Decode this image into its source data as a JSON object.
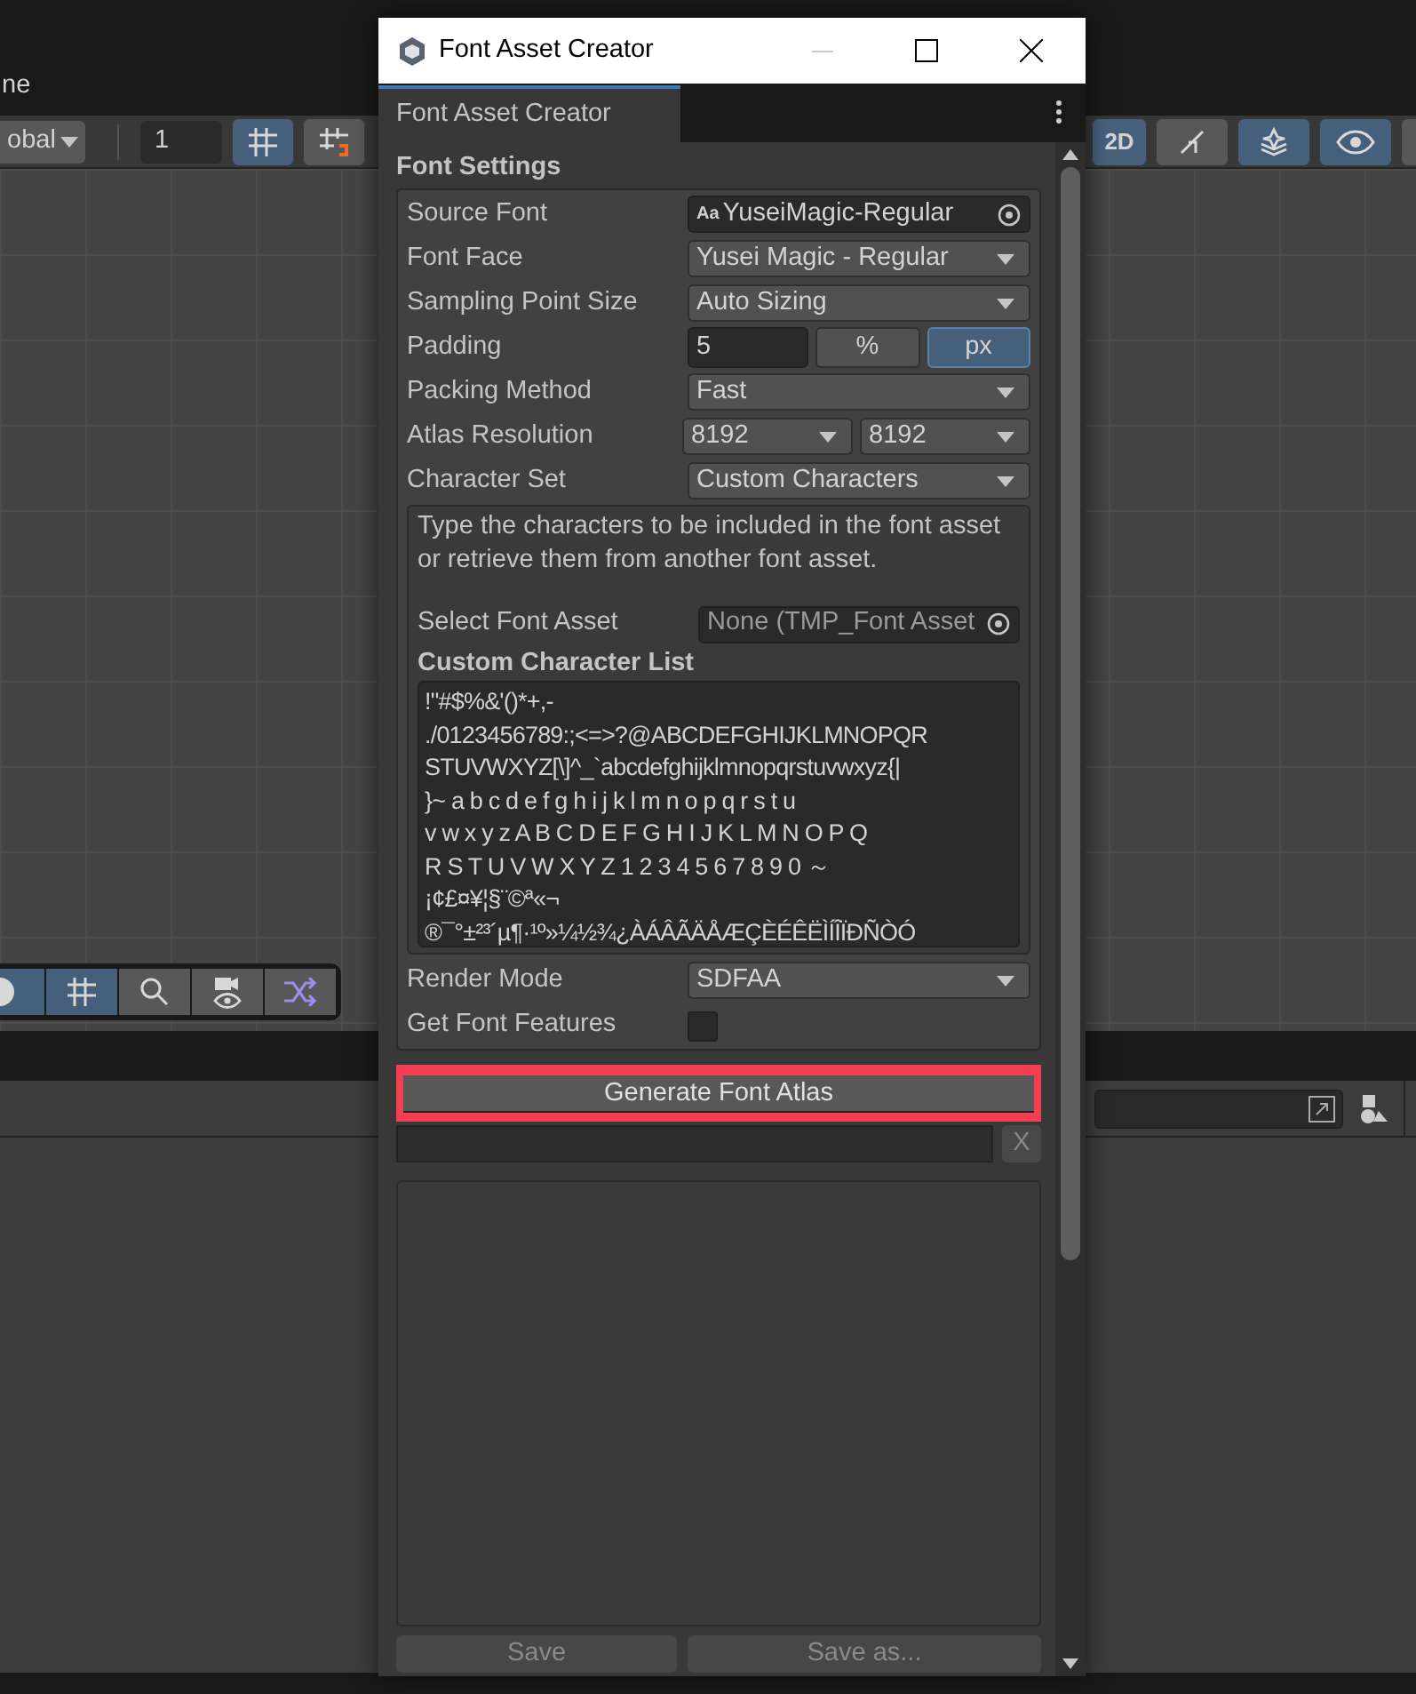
{
  "editor": {
    "menu_text": "ne",
    "pivot_dropdown": "obal",
    "grid_size": "1",
    "view_2d_label": "2D",
    "top_toggles": [
      {
        "kind": "grid",
        "on": true
      },
      {
        "kind": "snap",
        "on": false
      }
    ],
    "right_toggles": [
      {
        "kind": "lighting",
        "on": false
      },
      {
        "kind": "layers",
        "on": true
      },
      {
        "kind": "visibility",
        "on": true
      }
    ],
    "overlay_tools": [
      {
        "kind": "shape",
        "on": true
      },
      {
        "kind": "grid",
        "on": true
      },
      {
        "kind": "search",
        "on": false
      },
      {
        "kind": "camera",
        "on": false
      },
      {
        "kind": "shuffle",
        "on": false
      }
    ]
  },
  "window": {
    "title": "Font Asset Creator",
    "tab": {
      "label": "Font Asset Creator",
      "selected": true
    },
    "section_title": "Font Settings",
    "fields": [
      {
        "kind": "object",
        "label": "Source Font",
        "value": "YuseiMagic-Regular",
        "prefix": "Aa"
      },
      {
        "kind": "dropdown",
        "label": "Font Face",
        "value": "Yusei Magic - Regular"
      },
      {
        "kind": "dropdown",
        "label": "Sampling Point Size",
        "value": "Auto Sizing"
      },
      {
        "kind": "padding",
        "label": "Padding",
        "value": "5",
        "units": [
          {
            "label": "%",
            "selected": false
          },
          {
            "label": "px",
            "selected": true
          }
        ]
      },
      {
        "kind": "dropdown",
        "label": "Packing Method",
        "value": "Fast"
      },
      {
        "kind": "dual",
        "label": "Atlas Resolution",
        "values": [
          "8192",
          "8192"
        ]
      },
      {
        "kind": "dropdown",
        "label": "Character Set",
        "value": "Custom Characters"
      }
    ],
    "help_text": "Type the characters to be included in the font asset or retrieve them from another font asset.",
    "select_asset": {
      "label": "Select Font Asset",
      "value": "None (TMP_Font Asset"
    },
    "custom_list_title": "Custom Character List",
    "custom_list_lines": [
      "!\"#$%&'()*+,-",
      "./0123456789:;<=>?@ABCDEFGHIJKLMNOPQR",
      "STUVWXYZ[\\]^_`abcdefghijklmnopqrstuvwxyz{|",
      "}~ a b c d e f g h i j k l m n o p q r s t u",
      "v w x y z A B C D E F G H I J K L M N O P Q",
      "R S T U V W X Y Z 1 2 3 4 5 6 7 8 9 0 ～",
      "¡¢£¤¥¦§¨©ª«¬",
      "®¯°±²³´µ¶·¹º»¼½¾¿ÀÁÂÃÄÅÆÇÈÉÊËÌÍÎÏÐÑÒÓ"
    ],
    "render_mode": {
      "label": "Render Mode",
      "value": "SDFAA"
    },
    "font_features": {
      "label": "Get Font Features",
      "checked": false
    },
    "generate_button": {
      "label": "Generate Font Atlas",
      "highlighted": true
    },
    "clear_button": "X",
    "save_buttons": [
      "Save",
      "Save as..."
    ]
  }
}
